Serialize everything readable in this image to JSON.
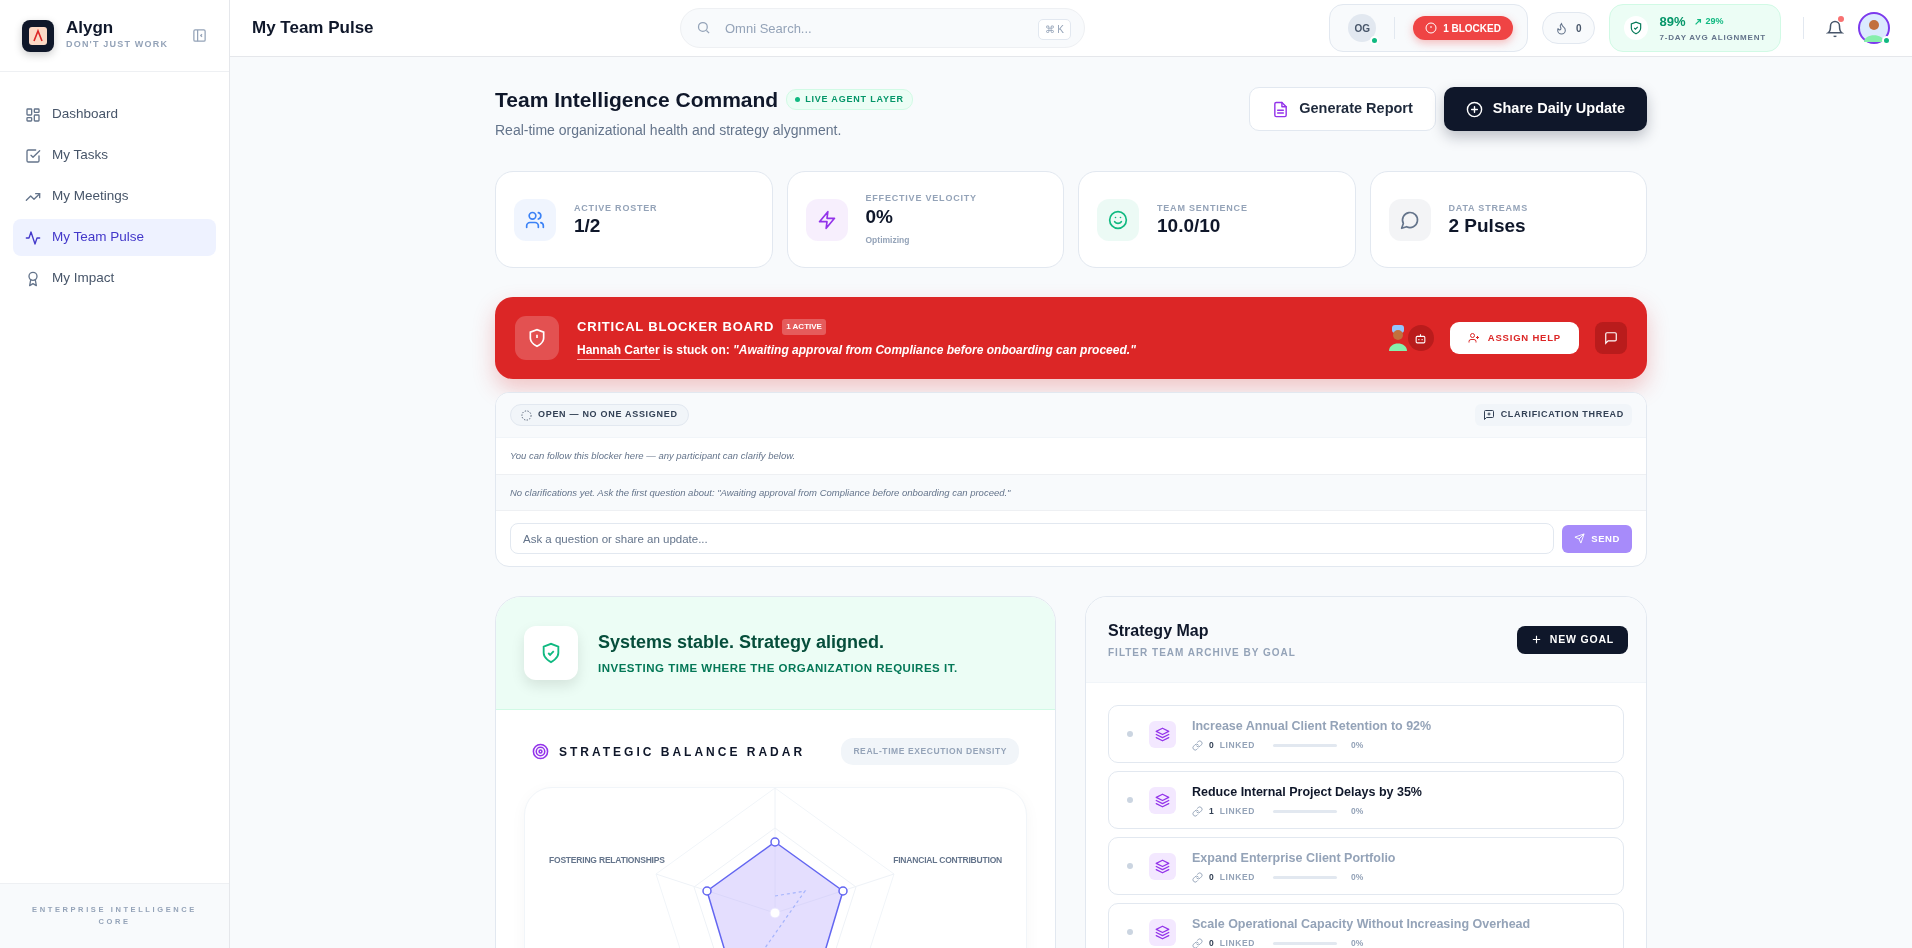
{
  "sidebar": {
    "brand": "Alygn",
    "tagline": "DON'T JUST WORK",
    "items": [
      {
        "label": "Dashboard",
        "selected": false
      },
      {
        "label": "My Tasks",
        "selected": false
      },
      {
        "label": "My Meetings",
        "selected": false
      },
      {
        "label": "My Team Pulse",
        "selected": true
      },
      {
        "label": "My Impact",
        "selected": false
      }
    ],
    "footer": "ENTERPRISE INTELLIGENCE CORE"
  },
  "header": {
    "title": "My Team Pulse",
    "search": {
      "placeholder": "Omni Search...",
      "shortcut": "⌘ K"
    },
    "user_initials": "OG",
    "blocked_badge": "1 BLOCKED",
    "streak": "0",
    "alignment": {
      "value": "89%",
      "change": "29%",
      "label": "7-DAY AVG ALIGNMENT"
    },
    "notifications_unread": true
  },
  "page": {
    "title": "Team Intelligence Command",
    "live_badge": "LIVE AGENT LAYER",
    "subtitle": "Real-time organizational health and strategy alygnment.",
    "actions": [
      {
        "label": "Generate Report",
        "kind": "secondary"
      },
      {
        "label": "Share Daily Update",
        "kind": "primary"
      }
    ]
  },
  "stats": [
    {
      "label": "ACTIVE ROSTER",
      "value": "1/2",
      "color": "#3b82f6"
    },
    {
      "label": "EFFECTIVE VELOCITY",
      "value": "0%",
      "note": "Optimizing",
      "color": "#9333ea"
    },
    {
      "label": "TEAM SENTIENCE",
      "value": "10.0/10",
      "color": "#10b981"
    },
    {
      "label": "DATA STREAMS",
      "value": "2 Pulses",
      "color": "#64748b"
    }
  ],
  "blocker": {
    "title": "CRITICAL BLOCKER BOARD",
    "count_badge": "1 ACTIVE",
    "person": "Hannah Carter",
    "stuck_text": "is stuck on:",
    "issue": "\"Awaiting approval from Compliance before onboarding can proceed.\"",
    "assign_button": "ASSIGN HELP"
  },
  "thread": {
    "status": "OPEN — NO ONE ASSIGNED",
    "thread_label": "CLARIFICATION THREAD",
    "info": "You can follow this blocker here — any participant can clarify below.",
    "empty": "No clarifications yet. Ask the first question about: \"Awaiting approval from Compliance before onboarding can proceed.\"",
    "input_placeholder": "Ask a question or share an update...",
    "send": "SEND",
    "send_disabled": true
  },
  "health": {
    "title": "Systems stable. Strategy aligned.",
    "subtitle": "INVESTING TIME WHERE THE ORGANIZATION REQUIRES IT."
  },
  "radar": {
    "title": "STRATEGIC BALANCE RADAR",
    "badge": "REAL-TIME EXECUTION DENSITY",
    "axis_labels": [
      "FOSTERING RELATIONSHIPS",
      "FINANCIAL CONTRIBUTION"
    ]
  },
  "strategy_map": {
    "title": "Strategy Map",
    "subtitle": "FILTER TEAM ARCHIVE BY GOAL",
    "new_button": "NEW GOAL",
    "goals": [
      {
        "title": "Increase Annual Client Retention to 92%",
        "linked_count": "0",
        "linked_label": "LINKED",
        "level": 0,
        "percent": "0%",
        "dimmed": true
      },
      {
        "title": "Reduce Internal Project Delays by 35%",
        "linked_count": "1",
        "linked_label": "LINKED",
        "level": 0,
        "percent": "0%",
        "dimmed": false
      },
      {
        "title": "Expand Enterprise Client Portfolio",
        "linked_count": "0",
        "linked_label": "LINKED",
        "level": 0,
        "percent": "0%",
        "dimmed": true
      },
      {
        "title": "Scale Operational Capacity Without Increasing Overhead",
        "linked_count": "0",
        "linked_label": "LINKED",
        "level": 0,
        "percent": "0%",
        "dimmed": true
      }
    ]
  }
}
